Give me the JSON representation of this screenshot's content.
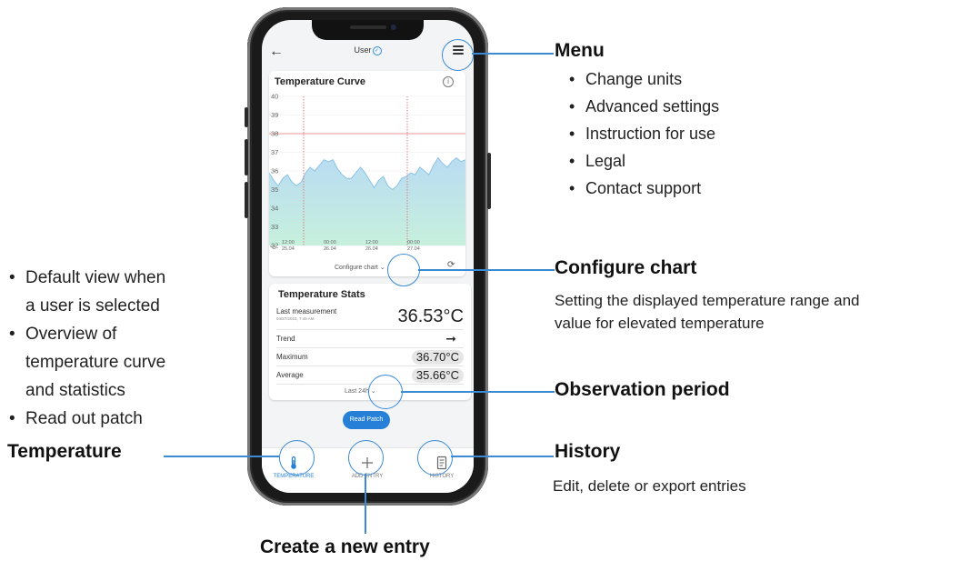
{
  "app": {
    "header_title": "User",
    "back_icon": "arrow-left-icon",
    "menu_icon": "hamburger-menu-icon"
  },
  "temperature_curve": {
    "title": "Temperature Curve",
    "info_icon": "i",
    "configure_chart_label": "Configure chart"
  },
  "chart_data": {
    "type": "area",
    "title": "Temperature Curve",
    "y_unit": "°C",
    "ylim": [
      32,
      40
    ],
    "y_ticks": [
      "40",
      "39",
      "38",
      "37",
      "36",
      "35",
      "34",
      "33",
      "32"
    ],
    "x_ticks": [
      {
        "time": "12:00",
        "date": "25.04"
      },
      {
        "time": "00:00",
        "date": "26.04"
      },
      {
        "time": "12:00",
        "date": "26.04"
      },
      {
        "time": "00:00",
        "date": "27.04"
      }
    ],
    "elevated_threshold": 38,
    "series": [
      {
        "values": [
          35.9,
          35.5,
          35.2,
          35.6,
          35.8,
          35.4,
          35.2,
          35.4,
          35.9,
          36.2,
          36.0,
          36.3,
          36.6,
          36.5,
          36.6,
          36.1,
          35.8,
          35.6,
          35.6,
          35.9,
          36.2,
          35.9,
          35.5,
          35.1,
          35.5,
          35.7,
          35.2,
          35.0,
          35.2,
          35.6,
          35.7,
          35.9,
          35.8,
          36.2,
          36.0,
          35.8,
          36.3,
          36.7,
          36.4,
          36.2,
          36.5,
          36.7,
          36.5,
          36.6
        ]
      }
    ],
    "fill_colors": [
      "#b9dcf2",
      "#c6f0dd"
    ],
    "threshold_color": "#e57373",
    "marker_color": "#e57373"
  },
  "stats": {
    "title": "Temperature Stats",
    "last_label": "Last measurement",
    "last_timestamp": "04/27/2023, 7:46 AM",
    "last_value": "36.53°C",
    "trend_label": "Trend",
    "trend_icon": "arrow-right-icon",
    "max_label": "Maximum",
    "max_value": "36.70°C",
    "avg_label": "Average",
    "avg_value": "35.66°C",
    "period_label": "Last 24h"
  },
  "read_patch_label": "Read Patch",
  "nav": {
    "items": [
      {
        "label": "TEMPERATURE",
        "icon": "thermometer-icon"
      },
      {
        "label": "ADD ENTRY",
        "icon": "plus-icon"
      },
      {
        "label": "HISTORY",
        "icon": "history-document-icon"
      }
    ]
  },
  "callouts": {
    "menu": {
      "title": "Menu",
      "items": [
        "Change units",
        "Advanced settings",
        "Instruction for use",
        "Legal",
        "Contact support"
      ]
    },
    "configure_chart": {
      "title": "Configure chart",
      "desc_line1": "Setting the displayed temperature range and",
      "desc_line2": "value for elevated temperature"
    },
    "observation": {
      "title": "Observation period"
    },
    "history": {
      "title": "History",
      "desc": "Edit, delete or export entries"
    },
    "create_entry": {
      "title": "Create a new entry"
    },
    "temperature": {
      "title": "Temperature",
      "items_lines": [
        [
          "Default view when",
          "a user is selected"
        ],
        [
          "Overview of",
          "temperature curve",
          "and statistics"
        ],
        [
          "Read out patch"
        ]
      ]
    }
  },
  "colors": {
    "accent": "#3a8ad6",
    "button_blue": "#2680d8"
  }
}
